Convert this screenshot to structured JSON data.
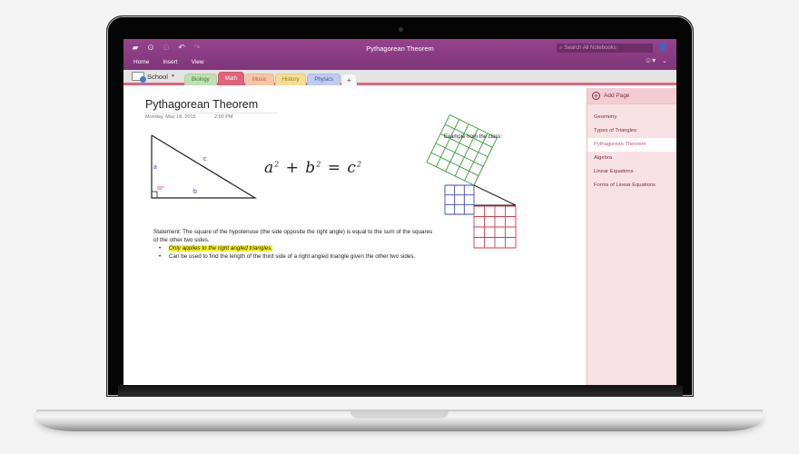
{
  "window": {
    "title": "Pythagorean Theorem",
    "search_placeholder": "Search All Notebooks",
    "toolbar_icons": [
      "folder-icon",
      "back-icon",
      "forward-icon",
      "undo-icon",
      "redo-icon"
    ]
  },
  "menu": {
    "items": [
      {
        "label": "Home"
      },
      {
        "label": "Insert"
      },
      {
        "label": "View"
      }
    ]
  },
  "notebook": {
    "name": "School",
    "sections": [
      {
        "label": "Biology",
        "color": "#bfe0b4",
        "text": "#3b7a2e",
        "active": false
      },
      {
        "label": "Math",
        "color": "#e2627a",
        "text": "#ffffff",
        "active": true
      },
      {
        "label": "Music",
        "color": "#f7c7a5",
        "text": "#b5603a",
        "active": false
      },
      {
        "label": "History",
        "color": "#f6dd93",
        "text": "#a07a1d",
        "active": false
      },
      {
        "label": "Physics",
        "color": "#c0cbee",
        "text": "#3f4fa0",
        "active": false
      }
    ],
    "add_section": "+"
  },
  "page": {
    "title": "Pythagorean Theorem",
    "date": "Monday, May 18, 2015",
    "time": "2:00 PM",
    "triangle_labels": {
      "a": "a",
      "b": "b",
      "c": "c",
      "angle": "90°"
    },
    "formula": {
      "a": "a",
      "b": "b",
      "c": "c",
      "exp": "2",
      "plus": "+",
      "eq": "="
    },
    "statement": "Statement: The square of the hypotenuse (the side opposite the right angle) is equal to the sum of the squares of the other two sides.",
    "bullets": [
      "Only applies to the right angled triangles.",
      "Can be used to find the length of the third side of a right angled triangle given the other two sides."
    ],
    "example_label": "Example from the class:",
    "colors": {
      "blue_square": "#3b47c4",
      "green_square": "#3a9a3a",
      "red_square": "#d83b4a",
      "angle": "#e03050",
      "ink": "#222222"
    }
  },
  "sidebar": {
    "add_page": "Add Page",
    "pages": [
      {
        "label": "Geometry",
        "active": false
      },
      {
        "label": "Types of Triangles",
        "active": false
      },
      {
        "label": "Pythagorean Theorem",
        "active": true
      },
      {
        "label": "Algebra",
        "active": false
      },
      {
        "label": "Linear Equations",
        "active": false
      },
      {
        "label": "Forms of Linear Equations",
        "active": false
      }
    ]
  },
  "theme": {
    "accent": "#8d3e85",
    "section_accent": "#e2627a",
    "sidebar_bg": "#f8e1e5"
  }
}
